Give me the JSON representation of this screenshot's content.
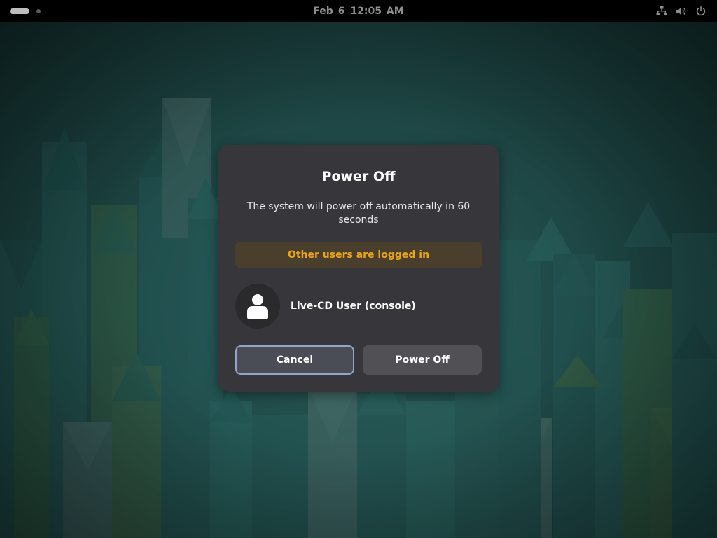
{
  "topbar": {
    "clock_date": "Feb 6",
    "clock_time": "12:05 AM",
    "tray_icons": [
      "network-icon",
      "volume-icon",
      "power-icon"
    ]
  },
  "dialog": {
    "title": "Power Off",
    "description": "The system will power off automatically in 60 seconds",
    "warning": "Other users are logged in",
    "users": [
      {
        "name": "Live-CD User (console)",
        "avatar": "user-icon"
      }
    ],
    "cancel_label": "Cancel",
    "confirm_label": "Power Off"
  },
  "colors": {
    "dialog_bg": "#37373b",
    "warning_text": "#e8a41a",
    "warning_bg": "#4a3f2c",
    "focus_border": "#8fa6cc"
  }
}
